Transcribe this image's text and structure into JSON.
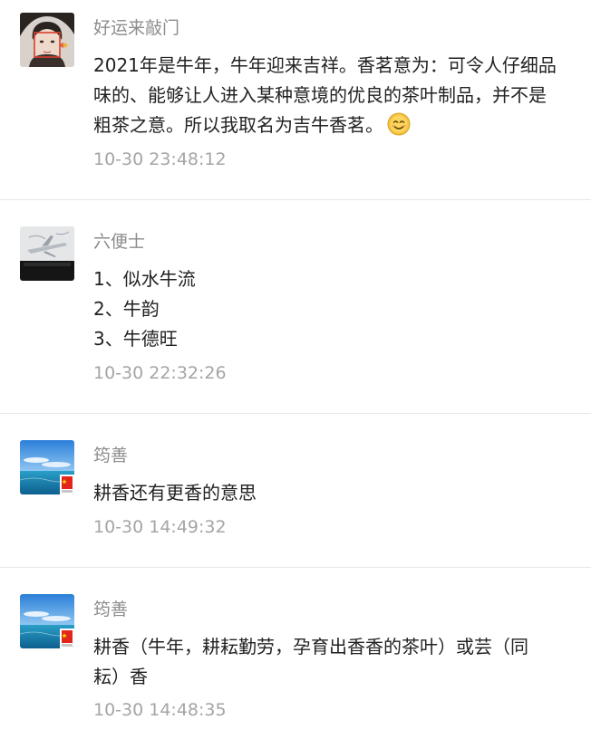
{
  "comments": [
    {
      "nickname": "好运来敲门",
      "lines": [
        "2021年是牛年，牛年迎来吉祥。香茗意为：可令人仔细品",
        "味的、能够让人进入某种意境的优良的茶叶制品，并不是",
        "粗茶之意。所以我取名为吉牛香茗。"
      ],
      "emoji": "smile-emoji",
      "time": "10-30 23:48:12",
      "avatar_icon": "portrait-avatar-icon"
    },
    {
      "nickname": "六便士",
      "lines": [
        "1、似水牛流",
        "2、牛韵",
        "3、牛德旺"
      ],
      "time": "10-30 22:32:26",
      "avatar_icon": "airplane-sketch-avatar-icon"
    },
    {
      "nickname": "筠善",
      "lines": [
        "耕香还有更香的意思"
      ],
      "time": "10-30 14:49:32",
      "avatar_icon": "sea-sky-avatar-icon"
    },
    {
      "nickname": "筠善",
      "lines": [
        "耕香（牛年，耕耘勤劳，孕育出香香的茶叶）或芸（同",
        "耘）香"
      ],
      "time": "10-30 14:48:35",
      "avatar_icon": "sea-sky-avatar-icon"
    }
  ],
  "colors": {
    "nickname": "#8c8c8c",
    "body": "#222222",
    "time": "#a5a5a5",
    "divider": "#e7e7e7",
    "emoji": "#f6c343"
  }
}
